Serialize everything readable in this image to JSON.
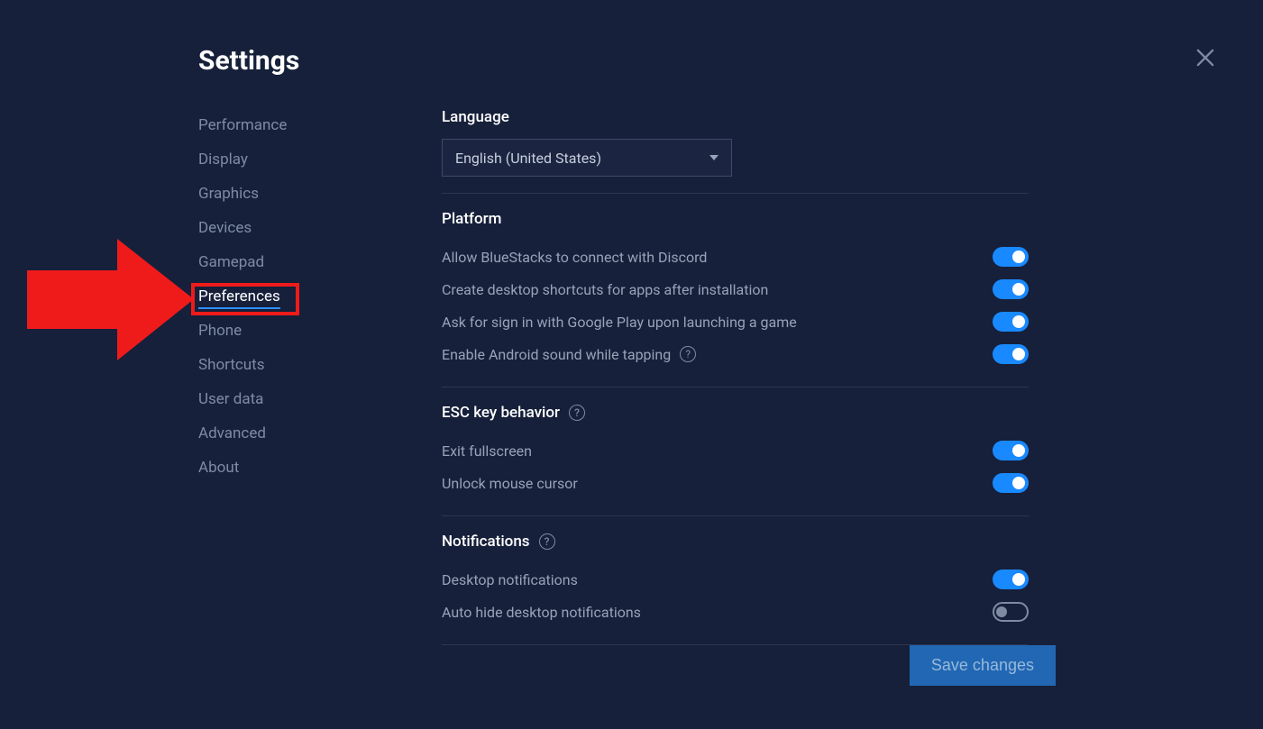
{
  "title": "Settings",
  "sidebar": {
    "items": [
      {
        "label": "Performance"
      },
      {
        "label": "Display"
      },
      {
        "label": "Graphics"
      },
      {
        "label": "Devices"
      },
      {
        "label": "Gamepad"
      },
      {
        "label": "Preferences"
      },
      {
        "label": "Phone"
      },
      {
        "label": "Shortcuts"
      },
      {
        "label": "User data"
      },
      {
        "label": "Advanced"
      },
      {
        "label": "About"
      }
    ],
    "active_index": 5
  },
  "sections": {
    "language": {
      "title": "Language",
      "selected": "English (United States)"
    },
    "platform": {
      "title": "Platform",
      "rows": [
        {
          "label": "Allow BlueStacks to connect with Discord",
          "on": true
        },
        {
          "label": "Create desktop shortcuts for apps after installation",
          "on": true
        },
        {
          "label": "Ask for sign in with Google Play upon launching a game",
          "on": true
        },
        {
          "label": "Enable Android sound while tapping",
          "on": true,
          "help": true
        }
      ]
    },
    "esc": {
      "title": "ESC key behavior",
      "help": true,
      "rows": [
        {
          "label": "Exit fullscreen",
          "on": true
        },
        {
          "label": "Unlock mouse cursor",
          "on": true
        }
      ]
    },
    "notifications": {
      "title": "Notifications",
      "help": true,
      "rows": [
        {
          "label": "Desktop notifications",
          "on": true
        },
        {
          "label": "Auto hide desktop notifications",
          "on": false
        }
      ]
    }
  },
  "save_label": "Save changes",
  "annotation": {
    "arrow_color": "#ef1b1b"
  }
}
